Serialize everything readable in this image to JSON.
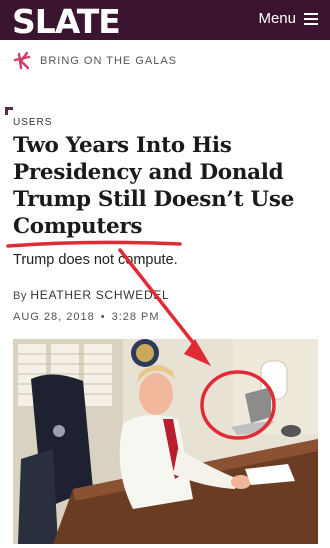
{
  "header": {
    "logo": "SLATE",
    "menu_label": "Menu",
    "menu_icon": "hamburger-icon"
  },
  "promo": {
    "label": "BRING ON THE GALAS",
    "icon": "slate-star-icon"
  },
  "article": {
    "kicker": "USERS",
    "headline": "Two Years Into His Presidency and Donald Trump Still Doesn’t Use Computers",
    "dek": "Trump does not compute.",
    "byline_prefix": "By",
    "author": "HEATHER SCHWEDEL",
    "date": "AUG 28, 2018",
    "separator": "•",
    "time": "3:28 PM"
  },
  "colors": {
    "header_bg": "#3b1530",
    "annotation": "#e02a35",
    "promo_icon": "#d63a66"
  }
}
